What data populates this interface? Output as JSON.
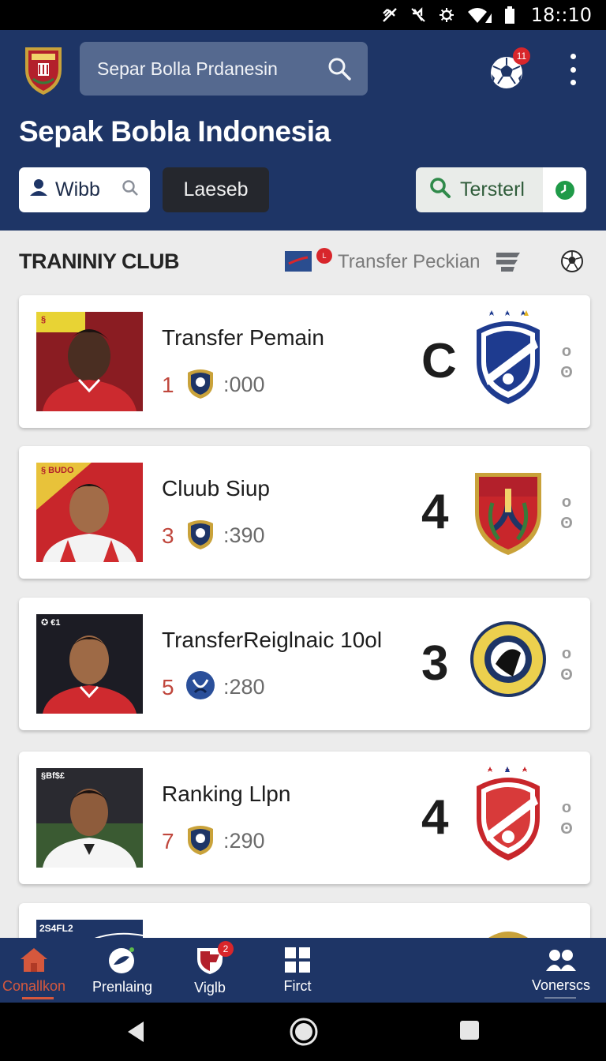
{
  "status_bar": {
    "time": "18::10",
    "icons": [
      "no-signal-icon",
      "mute-icon",
      "sync-icon",
      "wifi-icon",
      "battery-icon"
    ]
  },
  "header": {
    "search_value": "Separ Bolla Prdanesin",
    "search_icon": "search-icon",
    "notification_badge": "11",
    "title": "Sepak Bobla Indonesia"
  },
  "filters": {
    "user_chip": "Wibb",
    "dark_chip": "Laeseb",
    "filter_chip": "Tersterl"
  },
  "section": {
    "title": "TRANINIY CLUB",
    "badge": "L",
    "link": "Transfer Peckian"
  },
  "cards": [
    {
      "title": "Transfer Pemain",
      "rank": "1",
      "score": ":000",
      "big": "C",
      "photo_tag": "§ "
    },
    {
      "title": "Cluub Siup",
      "rank": "3",
      "score": ":390",
      "big": "4",
      "photo_tag": "§ BUDO"
    },
    {
      "title": "TransferReiglnaic 10ol",
      "rank": "5",
      "score": ":280",
      "big": "3",
      "photo_tag": "✪ €1"
    },
    {
      "title": "Ranking Llpn",
      "rank": "7",
      "score": ":290",
      "big": "4",
      "photo_tag": "§Bf$£"
    }
  ],
  "peek_card_tag": "2S4FL2",
  "bottom_nav": [
    {
      "label": "Conallkon",
      "icon": "home-icon"
    },
    {
      "label": "Prenlaing",
      "icon": "ball-icon"
    },
    {
      "label": "Viglb",
      "icon": "shield-icon",
      "badge": "2"
    },
    {
      "label": "Firct",
      "icon": "grid-icon"
    },
    {
      "label": "Vonerscs",
      "icon": "people-icon"
    }
  ],
  "colors": {
    "primary": "#1e3566",
    "accent": "#d8262b",
    "active_nav": "#d5583d",
    "rank_red": "#c0473d"
  }
}
